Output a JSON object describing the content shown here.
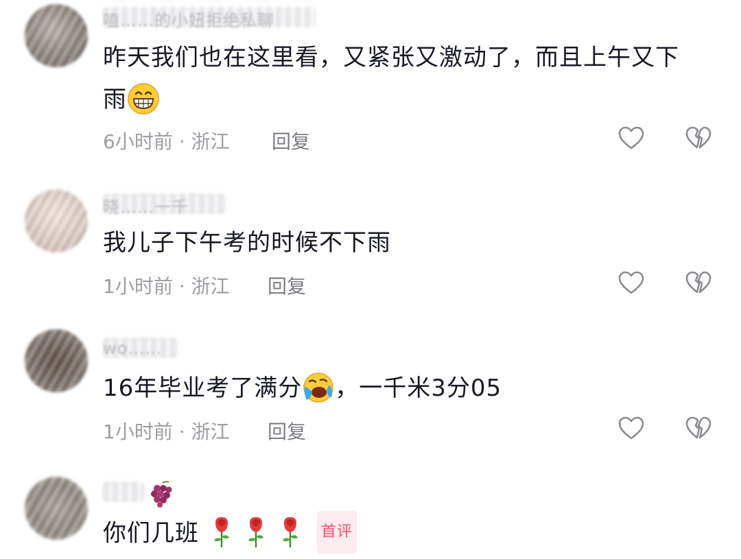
{
  "comments": [
    {
      "username": "嗑……的小妞拒绝私聊",
      "text_line1": "昨天我们也在这里看，又紧张又激动了，而且上午又下",
      "text_line2": "雨",
      "emoji": "grinning-face",
      "time": "6小时前",
      "separator": "·",
      "location": "浙江",
      "reply_label": "回复"
    },
    {
      "username": "晓……一千",
      "text": "我儿子下午考的时候不下雨",
      "time": "1小时前",
      "separator": "·",
      "location": "浙江",
      "reply_label": "回复"
    },
    {
      "username": "wo……",
      "text_before": "16年毕业考了满分",
      "emoji": "loudly-crying-face",
      "text_after": "，一千米3分05",
      "time": "1小时前",
      "separator": "·",
      "location": "浙江",
      "reply_label": "回复"
    },
    {
      "username_icon": "grapes",
      "text": "你们几班",
      "emoji": "rose",
      "emoji_count": 3,
      "badge": "首评"
    }
  ],
  "icons": {
    "like": "heart-outline-icon",
    "dislike": "broken-heart-outline-icon"
  },
  "colors": {
    "text": "#161823",
    "meta": "#9c9da1",
    "reply": "#7c7d82",
    "badge": "#f0506e",
    "icon": "#8a8b90"
  }
}
